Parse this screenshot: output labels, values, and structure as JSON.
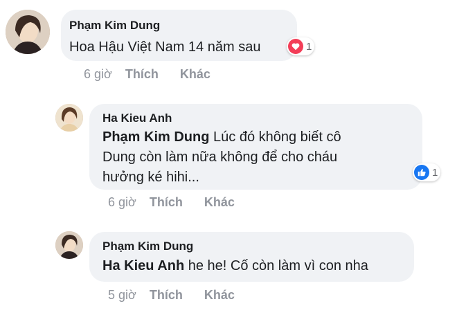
{
  "comments": [
    {
      "author": "Phạm Kim Dung",
      "text": "Hoa Hậu Việt Nam 14 năm sau",
      "time": "6 giờ",
      "like_label": "Thích",
      "more_label": "Khác",
      "reaction": {
        "icon": "heart-icon",
        "count": "1",
        "color": "#f33e58"
      }
    },
    {
      "author": "Ha Kieu Anh",
      "mention": "Phạm Kim Dung",
      "text_line1": "Lúc đó không biết cô",
      "text_line2": "Dung còn làm nữa không để cho cháu",
      "text_line3": "hưởng ké hihi...",
      "time": "6 giờ",
      "like_label": "Thích",
      "more_label": "Khác",
      "reaction": {
        "icon": "thumbs-up-icon",
        "count": "1",
        "color": "#1877f2"
      }
    },
    {
      "author": "Phạm Kim Dung",
      "mention": "Ha Kieu Anh",
      "text": "he he! Cố còn làm vì con nha",
      "time": "5 giờ",
      "like_label": "Thích",
      "more_label": "Khác"
    }
  ]
}
